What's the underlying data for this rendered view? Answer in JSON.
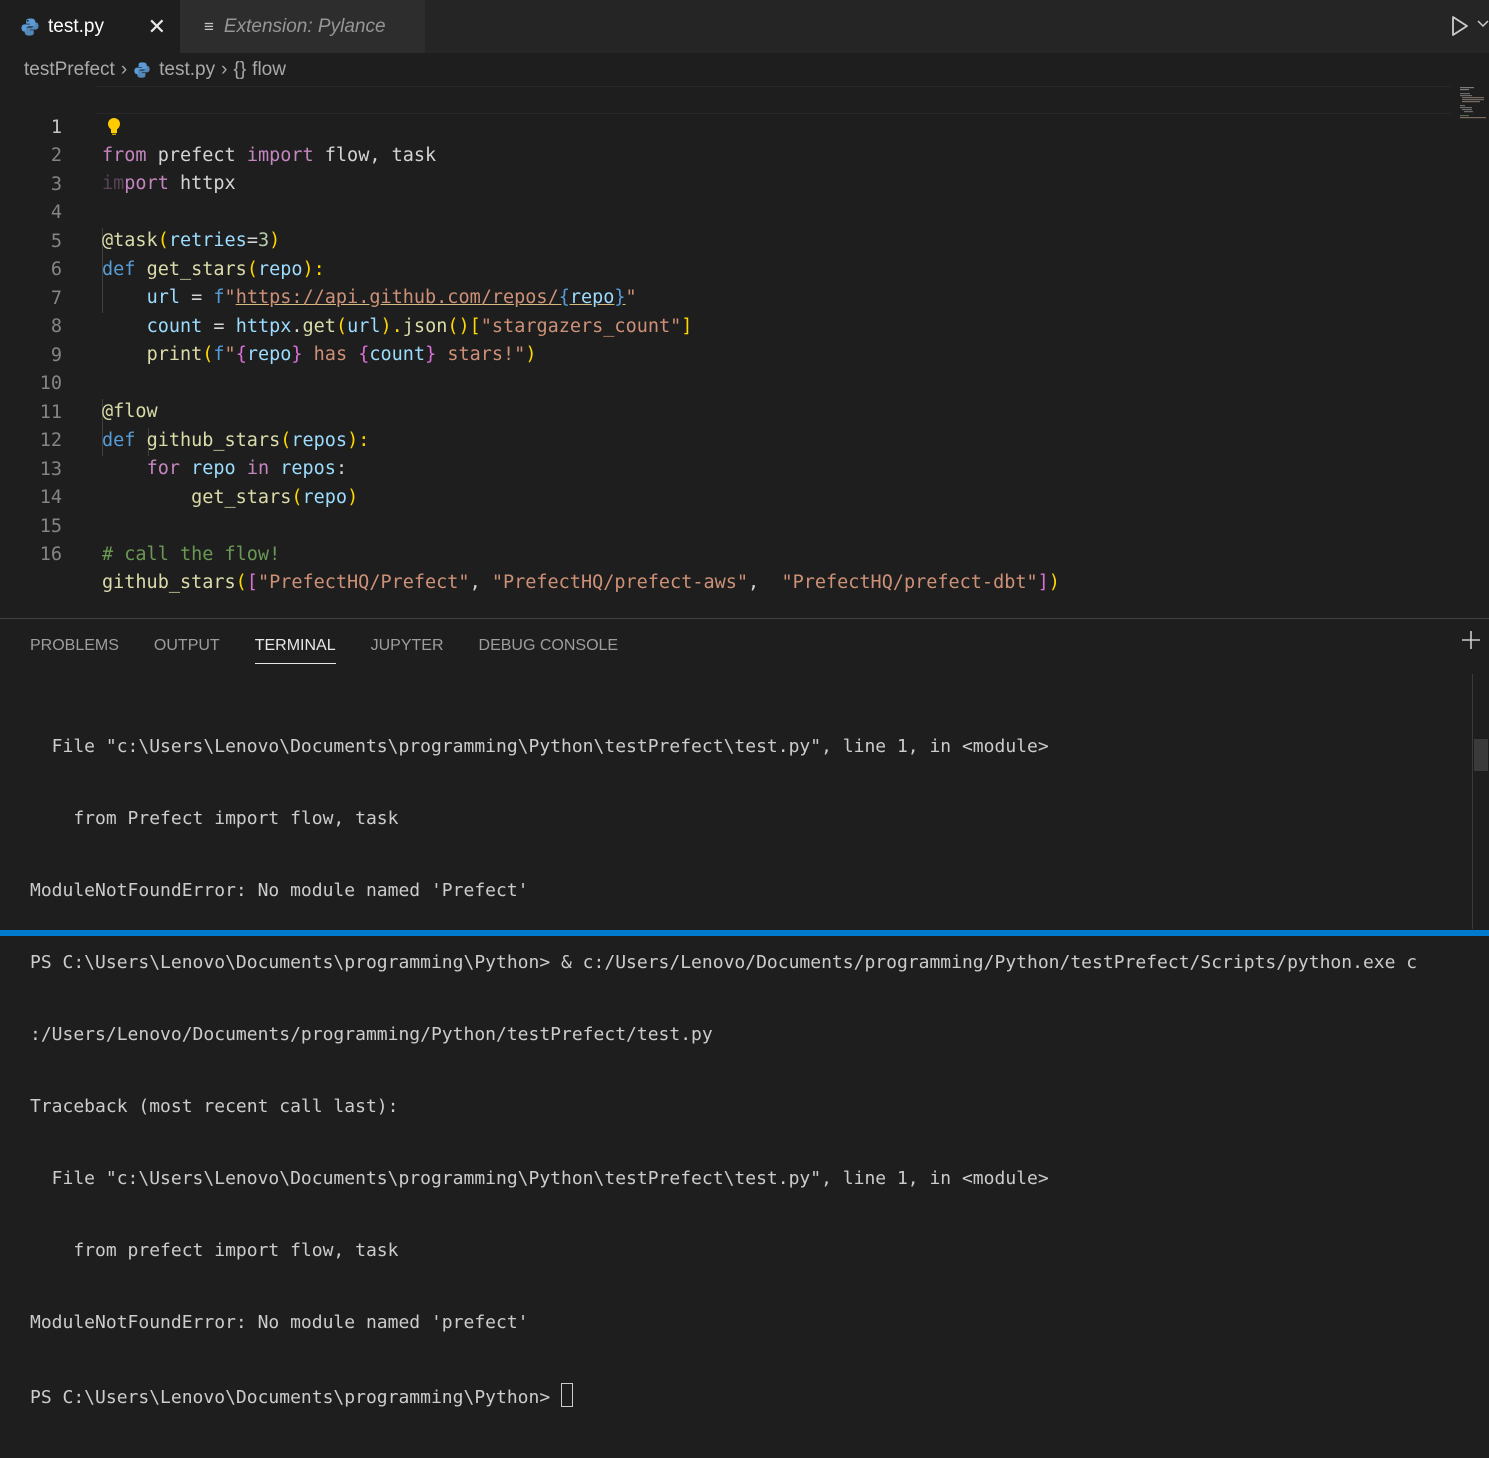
{
  "tabs": [
    {
      "label": "test.py",
      "active": true
    },
    {
      "label": "Extension: Pylance",
      "active": false
    }
  ],
  "breadcrumb": {
    "folder": "testPrefect",
    "file": "test.py",
    "symbol_glyph": "{}",
    "symbol": "flow"
  },
  "editor": {
    "line_numbers": [
      "1",
      "2",
      "3",
      "4",
      "5",
      "6",
      "7",
      "8",
      "9",
      "10",
      "11",
      "12",
      "13",
      "14",
      "15",
      "16"
    ],
    "lines": {
      "l1": [
        "from",
        "prefect",
        "import",
        "flow, task"
      ],
      "l2": [
        "im",
        "port",
        "httpx"
      ],
      "l4": [
        "@task",
        "(",
        "retries",
        "=",
        "3",
        ")"
      ],
      "l5": [
        "def",
        "get_stars",
        "(",
        "repo",
        "):"
      ],
      "l6": [
        "url",
        " = ",
        "f",
        "\"",
        "https://api.github.com/repos/",
        "{",
        "repo",
        "}",
        "\""
      ],
      "l7": [
        "count",
        " = ",
        "httpx",
        ".",
        "get",
        "(",
        "url",
        ").",
        "json",
        "()",
        "[",
        "\"stargazers_count\"",
        "]"
      ],
      "l8": [
        "print",
        "(",
        "f",
        "\"",
        "{",
        "repo",
        "}",
        " has ",
        "{",
        "count",
        "}",
        " stars!\"",
        ")"
      ],
      "l10": [
        "@flow"
      ],
      "l11": [
        "def",
        "github_stars",
        "(",
        "repos",
        "):"
      ],
      "l12": [
        "for",
        "repo",
        "in",
        "repos",
        ":"
      ],
      "l13": [
        "get_stars",
        "(",
        "repo",
        ")"
      ],
      "l15": [
        "# call the flow!"
      ],
      "l16": [
        "github_stars",
        "(",
        "[",
        "\"PrefectHQ/Prefect\"",
        ", ",
        "\"PrefectHQ/prefect-aws\"",
        ",  ",
        "\"PrefectHQ/prefect-dbt\"",
        "]",
        ")"
      ]
    }
  },
  "panel": {
    "tabs": [
      "PROBLEMS",
      "OUTPUT",
      "TERMINAL",
      "JUPYTER",
      "DEBUG CONSOLE"
    ],
    "active_tab": "TERMINAL",
    "terminal_lines": [
      "  File \"c:\\Users\\Lenovo\\Documents\\programming\\Python\\testPrefect\\test.py\", line 1, in <module>",
      "    from Prefect import flow, task",
      "ModuleNotFoundError: No module named 'Prefect'",
      "PS C:\\Users\\Lenovo\\Documents\\programming\\Python> & c:/Users/Lenovo/Documents/programming/Python/testPrefect/Scripts/python.exe c",
      ":/Users/Lenovo/Documents/programming/Python/testPrefect/test.py",
      "Traceback (most recent call last):",
      "  File \"c:\\Users\\Lenovo\\Documents\\programming\\Python\\testPrefect\\test.py\", line 1, in <module>",
      "    from prefect import flow, task",
      "ModuleNotFoundError: No module named 'prefect'"
    ],
    "prompt": "PS C:\\Users\\Lenovo\\Documents\\programming\\Python> "
  },
  "colors": {
    "accent": "#007acc",
    "background": "#1e1e1e",
    "tabbar": "#252526"
  },
  "icons": [
    "python-file-icon",
    "close-icon",
    "preview-icon",
    "run-icon",
    "chevron-down-icon",
    "lightbulb-icon",
    "plus-icon"
  ]
}
